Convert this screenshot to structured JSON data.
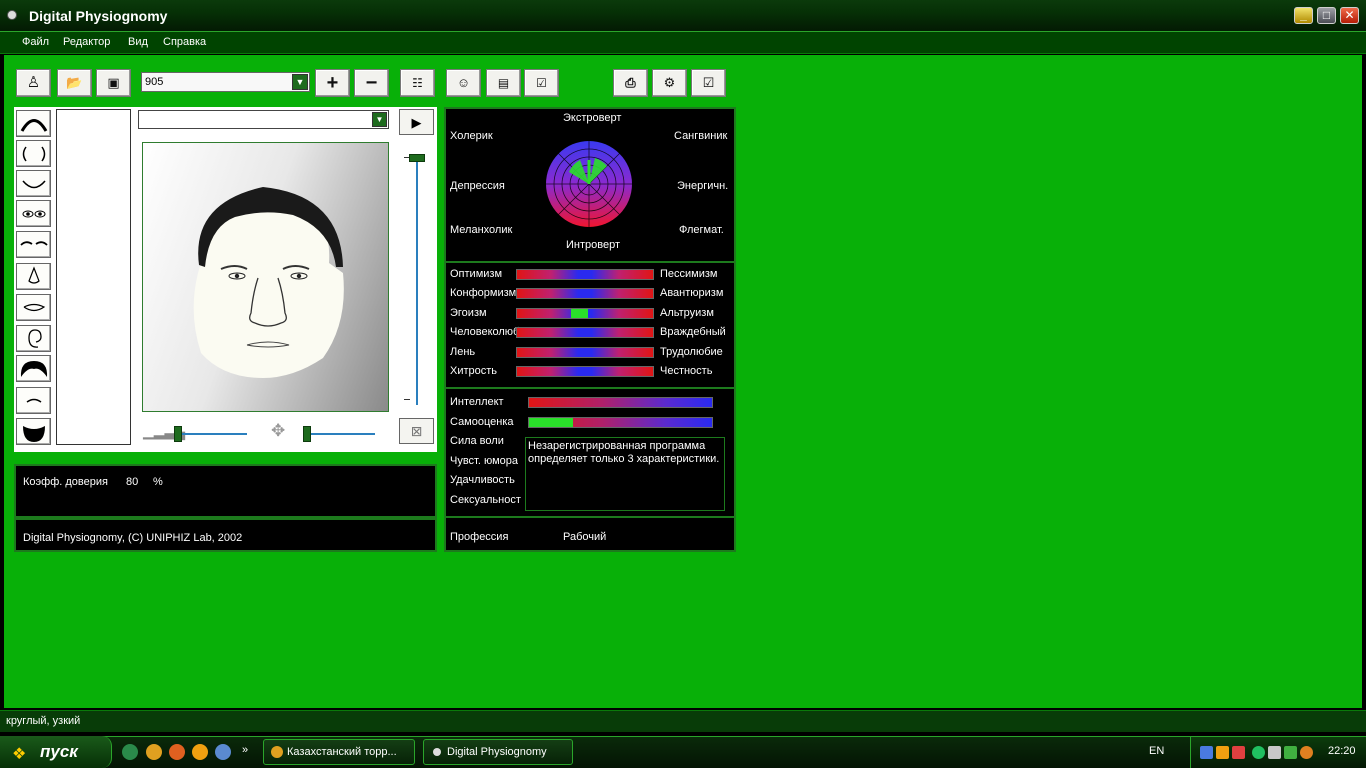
{
  "window": {
    "title": "Digital Physiognomy"
  },
  "menu": [
    "Файл",
    "Редактор",
    "Вид",
    "Справка"
  ],
  "toolbar": {
    "combo_value": "905",
    "buttons": [
      "new-face",
      "open-folder",
      "save",
      "add",
      "remove",
      "edit-list",
      "face-profile",
      "document",
      "checklist-edit",
      "print",
      "settings-search",
      "checkbox"
    ]
  },
  "temperament": {
    "top": "Экстроверт",
    "bottom": "Интроверт",
    "top_left": "Холерик",
    "top_right": "Сангвиник",
    "mid_left": "Депрессия",
    "mid_right": "Энергичн.",
    "bottom_left": "Меланхолик",
    "bottom_right": "Флегмат."
  },
  "traits": [
    {
      "left": "Оптимизм",
      "right": "Пессимизм",
      "marker": null
    },
    {
      "left": "Конформизм",
      "right": "Авантюризм",
      "marker": null
    },
    {
      "left": "Эгоизм",
      "right": "Альтруизм",
      "marker": 0.45
    },
    {
      "left": "Человеколюб",
      "right": "Враждебный",
      "marker": null
    },
    {
      "left": "Лень",
      "right": "Трудолюбие",
      "marker": null
    },
    {
      "left": "Хитрость",
      "right": "Честность",
      "marker": null
    }
  ],
  "qualities": {
    "intellect": "Интеллект",
    "self_esteem": "Самооценка",
    "self_esteem_level": 0.24,
    "willpower": "Сила воли",
    "humor": "Чувст. юмора",
    "luck": "Удачливость",
    "sexuality": "Сексуальност",
    "message": "Незарегистрированная программа определяет только 3 характеристики."
  },
  "profession": {
    "label": "Профессия",
    "value": "Рабочий"
  },
  "trust": {
    "label": "Коэфф. доверия",
    "value": "80",
    "unit": "%"
  },
  "copyright": "Digital Physiognomy, (C) UNIPHIZ Lab, 2002",
  "status": "круглый, узкий",
  "taskbar": {
    "start": "пуск",
    "items": [
      "Казахстанский торр...",
      "Digital Physiognomy"
    ],
    "lang": "EN",
    "clock": "22:20"
  },
  "colors": {
    "background": "#08b008",
    "panel": "#000000",
    "border": "#1d7a1d",
    "bar_red": "#e01515",
    "bar_blue": "#2a2af0",
    "marker": "#2adf2a"
  }
}
